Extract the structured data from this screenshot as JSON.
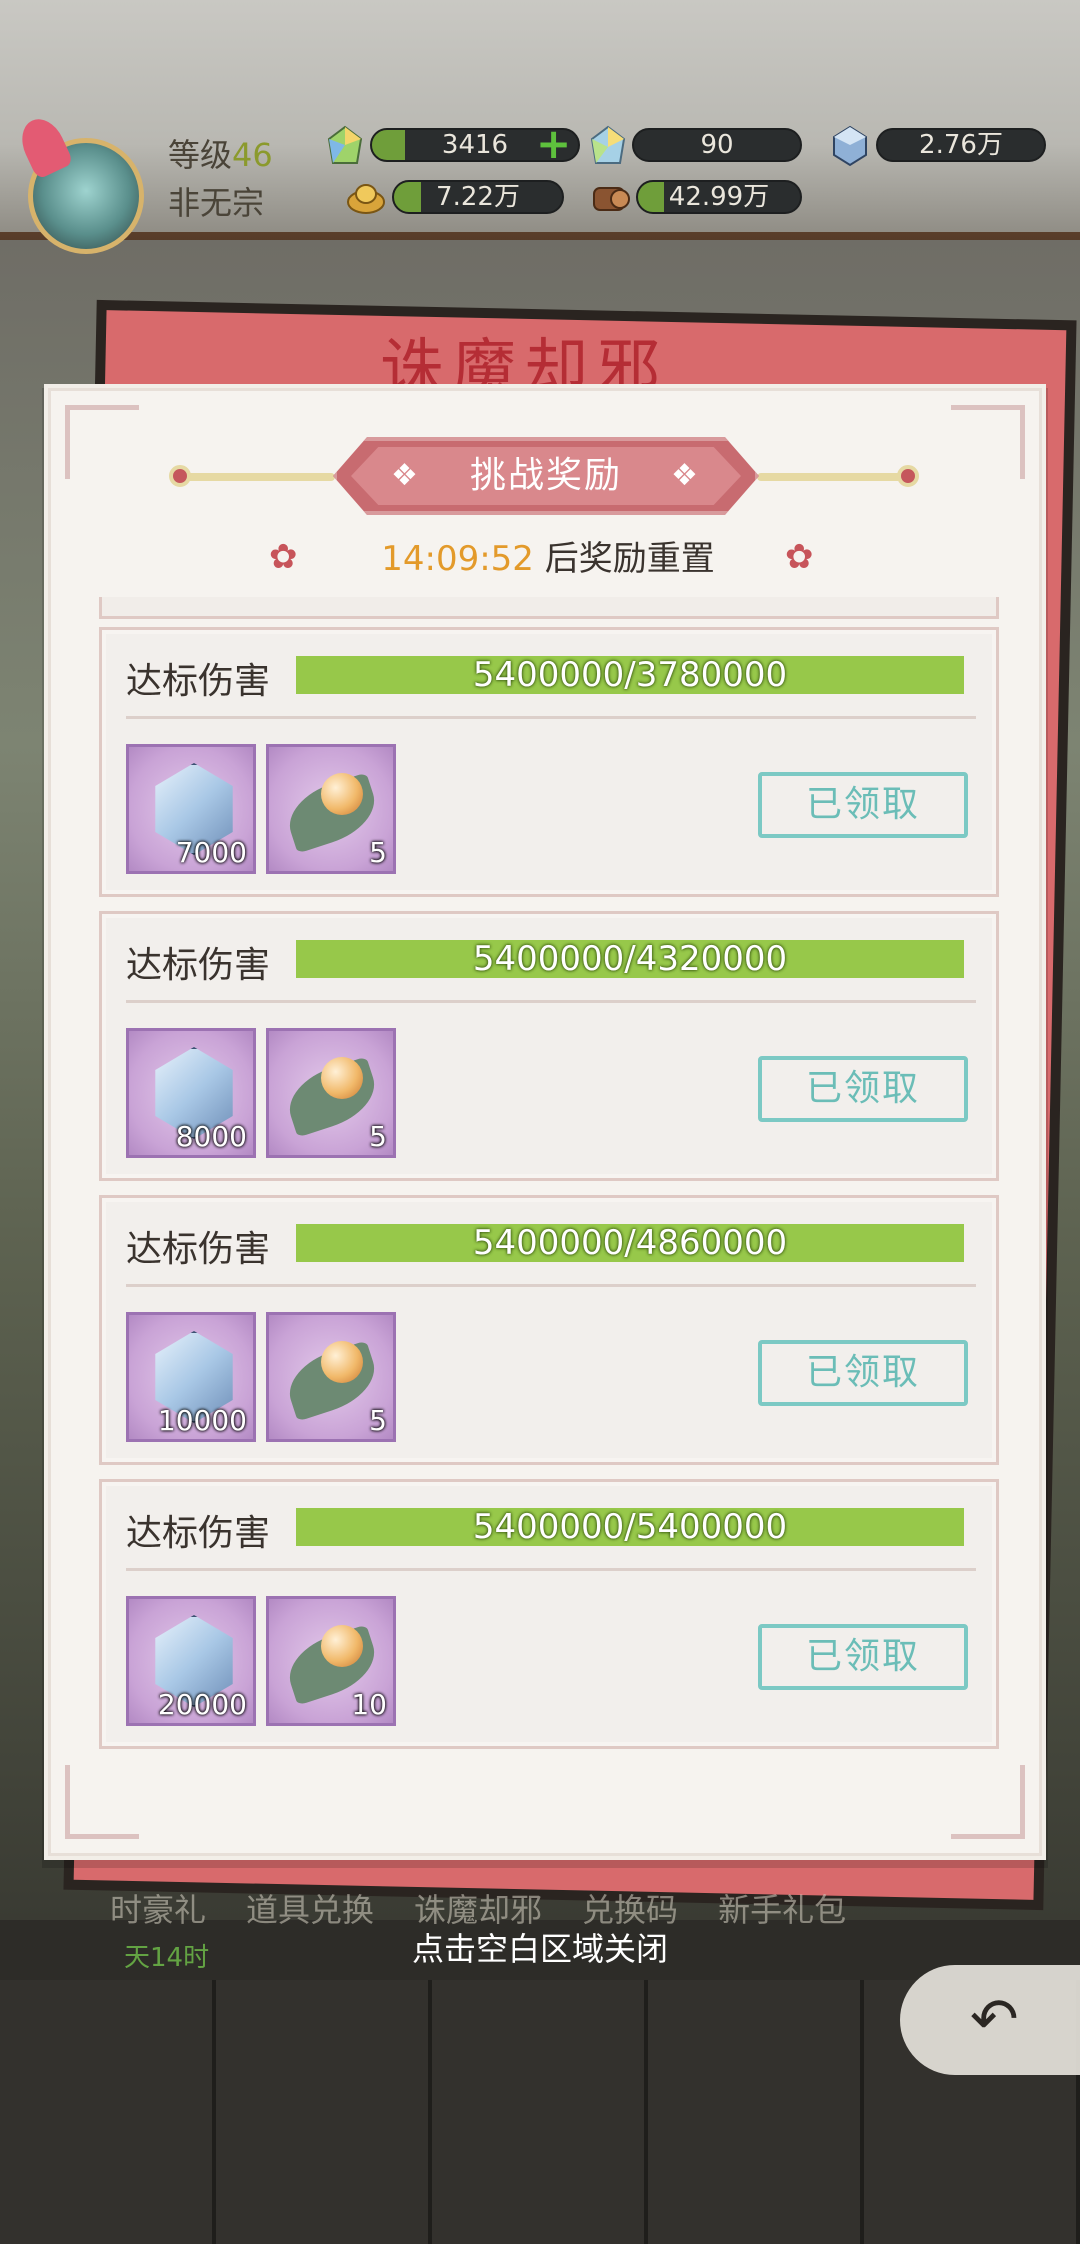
{
  "hud": {
    "level_label": "等级",
    "level_value": "46",
    "sect_name": "非无宗",
    "resources": [
      {
        "icon": "rainbow-crystal-icon",
        "value": "3416",
        "has_plus": true
      },
      {
        "icon": "crystal-bundle-icon",
        "value": "90"
      },
      {
        "icon": "blue-gem-icon",
        "value": "2.76万"
      },
      {
        "icon": "gold-ingot-icon",
        "value": "7.22万"
      },
      {
        "icon": "wood-log-icon",
        "value": "42.99万"
      }
    ]
  },
  "popup": {
    "title": "挑战奖励",
    "reset_time": "14:09:52",
    "reset_suffix": "后奖励重置",
    "rows": [
      {
        "label": "达标伤害",
        "progress_text": "5400000/3780000",
        "rewards": [
          {
            "icon": "blue-gem-icon",
            "count": "7000"
          },
          {
            "icon": "pearl-leaf-icon",
            "count": "5"
          }
        ],
        "button": "已领取"
      },
      {
        "label": "达标伤害",
        "progress_text": "5400000/4320000",
        "rewards": [
          {
            "icon": "blue-gem-icon",
            "count": "8000"
          },
          {
            "icon": "pearl-leaf-icon",
            "count": "5"
          }
        ],
        "button": "已领取"
      },
      {
        "label": "达标伤害",
        "progress_text": "5400000/4860000",
        "rewards": [
          {
            "icon": "blue-gem-icon",
            "count": "10000"
          },
          {
            "icon": "pearl-leaf-icon",
            "count": "5"
          }
        ],
        "button": "已领取"
      },
      {
        "label": "达标伤害",
        "progress_text": "5400000/5400000",
        "rewards": [
          {
            "icon": "blue-gem-icon",
            "count": "20000"
          },
          {
            "icon": "pearl-leaf-icon",
            "count": "10"
          }
        ],
        "button": "已领取"
      }
    ]
  },
  "background": {
    "title_partial": "诛魔却邪",
    "menu": [
      "时豪礼",
      "道具兑换",
      "诛魔却邪",
      "兑换码",
      "新手礼包"
    ],
    "menu_sub": "天14时"
  },
  "close_hint": "点击空白区域关闭",
  "colors": {
    "accent": "#c86b70",
    "progress": "#97c84a",
    "claimed": "#6bbdb7",
    "timer": "#e39a2a"
  }
}
